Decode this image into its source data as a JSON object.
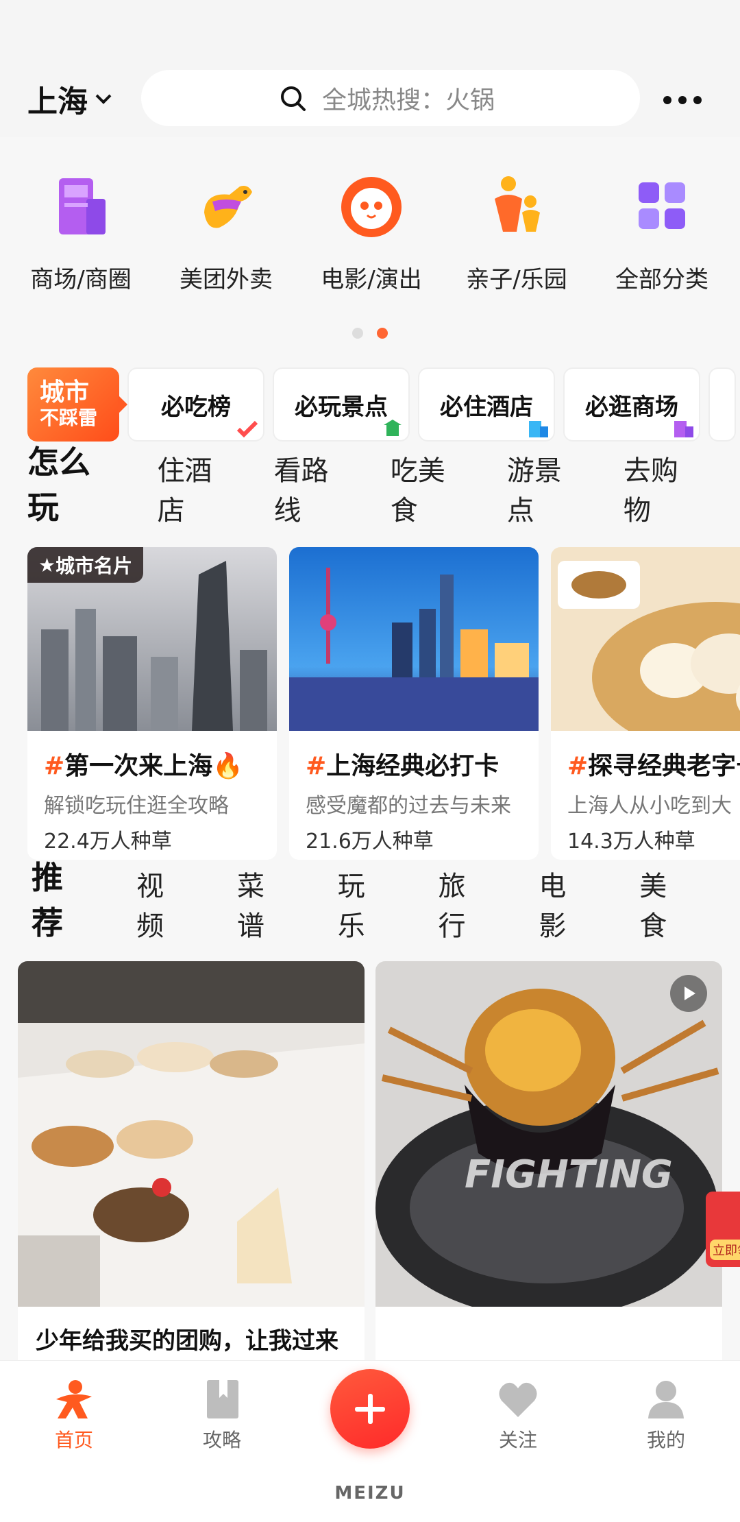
{
  "header": {
    "city": "上海",
    "search_placeholder": "全城热搜：火锅"
  },
  "categories": [
    {
      "label": "商场/商圈",
      "icon": "mall-building-icon"
    },
    {
      "label": "美团外卖",
      "icon": "kangaroo-delivery-icon"
    },
    {
      "label": "电影/演出",
      "icon": "cat-movie-icon"
    },
    {
      "label": "亲子/乐园",
      "icon": "parent-child-icon"
    },
    {
      "label": "全部分类",
      "icon": "grid-categories-icon"
    }
  ],
  "page_indicator": {
    "count": 2,
    "active": 2
  },
  "city_strip": {
    "badge_line1": "城市",
    "badge_line2": "不踩雷",
    "items": [
      "必吃榜",
      "必玩景点",
      "必住酒店",
      "必逛商场"
    ]
  },
  "play_tabs": {
    "active": "怎么玩",
    "items": [
      "住酒店",
      "看路线",
      "吃美食",
      "游景点",
      "去购物"
    ]
  },
  "play_cards": [
    {
      "tag": "城市名片",
      "title": "第一次来上海🔥",
      "subtitle": "解锁吃玩住逛全攻略",
      "count": "22.4万人种草"
    },
    {
      "tag": "",
      "title": "上海经典必打卡",
      "subtitle": "感受魔都的过去与未来",
      "count": "21.6万人种草"
    },
    {
      "tag": "",
      "title": "探寻经典老字号",
      "subtitle": "上海人从小吃到大",
      "count": "14.3万人种草"
    }
  ],
  "recommend_tabs": {
    "active": "推荐",
    "items": [
      "视频",
      "菜谱",
      "玩乐",
      "旅行",
      "电影",
      "美食"
    ]
  },
  "feed": [
    {
      "title": "少年给我买的团购，让我过来提，因为没有提前预约",
      "video": false
    },
    {
      "title": "",
      "video": true,
      "overlay_text": "FIGHTING"
    }
  ],
  "float_badge": "立即领",
  "bottom_nav": [
    {
      "label": "首页",
      "icon": "home-icon",
      "active": true
    },
    {
      "label": "攻略",
      "icon": "bookmark-icon",
      "active": false
    },
    {
      "label": "关注",
      "icon": "heart-icon",
      "active": false
    },
    {
      "label": "我的",
      "icon": "profile-icon",
      "active": false
    }
  ],
  "device_brand": "MEIZU",
  "colors": {
    "accent": "#ff5a1f",
    "accent_red": "#ff2a2a"
  }
}
